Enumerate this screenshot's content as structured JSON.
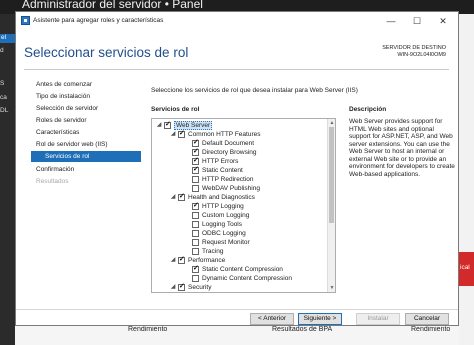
{
  "background": {
    "title": "Administrador del servidor • Panel",
    "left_items": [
      "el",
      "d",
      "",
      "S",
      "ca",
      "DL"
    ],
    "right_red_text": "ical",
    "tiles": [
      "Rendimiento",
      "Resultados de BPA",
      "Rendimiento"
    ]
  },
  "dialog": {
    "title": "Asistente para agregar roles y características",
    "header_title": "Seleccionar servicios de rol",
    "dest_label": "SERVIDOR DE DESTINO",
    "dest_server": "WIN-9O2L04I0OM9",
    "nav": [
      {
        "label": "Antes de comenzar",
        "state": "normal"
      },
      {
        "label": "Tipo de instalación",
        "state": "normal"
      },
      {
        "label": "Selección de servidor",
        "state": "normal"
      },
      {
        "label": "Roles de servidor",
        "state": "normal"
      },
      {
        "label": "Características",
        "state": "normal"
      },
      {
        "label": "Rol de servidor web (IIS)",
        "state": "normal"
      },
      {
        "label": "Servicios de rol",
        "state": "selected"
      },
      {
        "label": "Confirmación",
        "state": "normal"
      },
      {
        "label": "Resultados",
        "state": "disabled"
      }
    ],
    "intro": "Seleccione los servicios de rol que desea instalar para Web Server (IIS)",
    "roles_label": "Servicios de rol",
    "desc_label": "Descripción",
    "description": "Web Server provides support for HTML Web sites and optional support for ASP.NET, ASP, and Web server extensions. You can use the Web Server to host an internal or external Web site or to provide an environment for developers to create Web-based applications.",
    "tree": [
      {
        "label": "Web Server",
        "level": 0,
        "expander": "◢",
        "checked": true,
        "selected": true
      },
      {
        "label": "Common HTTP Features",
        "level": 1,
        "expander": "◢",
        "checked": true
      },
      {
        "label": "Default Document",
        "level": 2,
        "expander": "",
        "checked": true
      },
      {
        "label": "Directory Browsing",
        "level": 2,
        "expander": "",
        "checked": true
      },
      {
        "label": "HTTP Errors",
        "level": 2,
        "expander": "",
        "checked": true
      },
      {
        "label": "Static Content",
        "level": 2,
        "expander": "",
        "checked": true
      },
      {
        "label": "HTTP Redirection",
        "level": 2,
        "expander": "",
        "checked": false
      },
      {
        "label": "WebDAV Publishing",
        "level": 2,
        "expander": "",
        "checked": false
      },
      {
        "label": "Health and Diagnostics",
        "level": 1,
        "expander": "◢",
        "checked": true
      },
      {
        "label": "HTTP Logging",
        "level": 2,
        "expander": "",
        "checked": true
      },
      {
        "label": "Custom Logging",
        "level": 2,
        "expander": "",
        "checked": false
      },
      {
        "label": "Logging Tools",
        "level": 2,
        "expander": "",
        "checked": false
      },
      {
        "label": "ODBC Logging",
        "level": 2,
        "expander": "",
        "checked": false
      },
      {
        "label": "Request Monitor",
        "level": 2,
        "expander": "",
        "checked": false
      },
      {
        "label": "Tracing",
        "level": 2,
        "expander": "",
        "checked": false
      },
      {
        "label": "Performance",
        "level": 1,
        "expander": "◢",
        "checked": true
      },
      {
        "label": "Static Content Compression",
        "level": 2,
        "expander": "",
        "checked": true
      },
      {
        "label": "Dynamic Content Compression",
        "level": 2,
        "expander": "",
        "checked": false
      },
      {
        "label": "Security",
        "level": 1,
        "expander": "◢",
        "checked": true
      }
    ],
    "buttons": {
      "prev": "< Anterior",
      "next": "Siguiente >",
      "install": "Instalar",
      "cancel": "Cancelar"
    }
  }
}
